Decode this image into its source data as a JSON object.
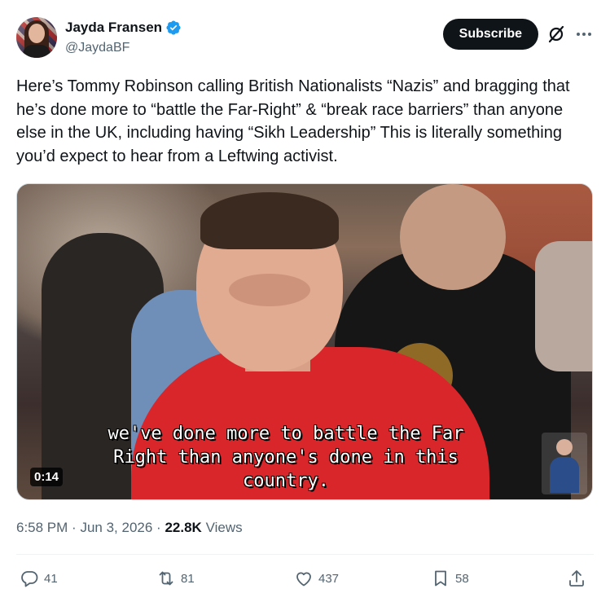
{
  "author": {
    "display_name": "Jayda Fransen",
    "handle": "@JaydaBF",
    "verified": true,
    "verified_color": "#1d9bf0"
  },
  "header": {
    "subscribe_label": "Subscribe",
    "grok_icon": "grok-icon",
    "more_icon": "more-icon"
  },
  "tweet": {
    "text": "Here’s Tommy Robinson calling British Nationalists “Nazis” and bragging that he’s done more to “battle the Far-Right” & “break race barriers” than anyone else in the UK, including having “Sikh Leadership” This is literally something you’d expect to hear from a Leftwing activist."
  },
  "media": {
    "subtitle_lines": [
      "we've done more to battle the Far",
      "Right than anyone's done in this",
      "country."
    ],
    "duration": "0:14"
  },
  "meta": {
    "time": "6:58 PM",
    "separator": "·",
    "date": "Jun 3, 2026",
    "views_count": "22.8K",
    "views_label": "Views"
  },
  "actions": {
    "replies": "41",
    "reposts": "81",
    "likes": "437",
    "bookmarks": "58"
  },
  "colors": {
    "text_primary": "#0f1419",
    "text_secondary": "#536471",
    "subscribe_bg": "#0f1419"
  }
}
